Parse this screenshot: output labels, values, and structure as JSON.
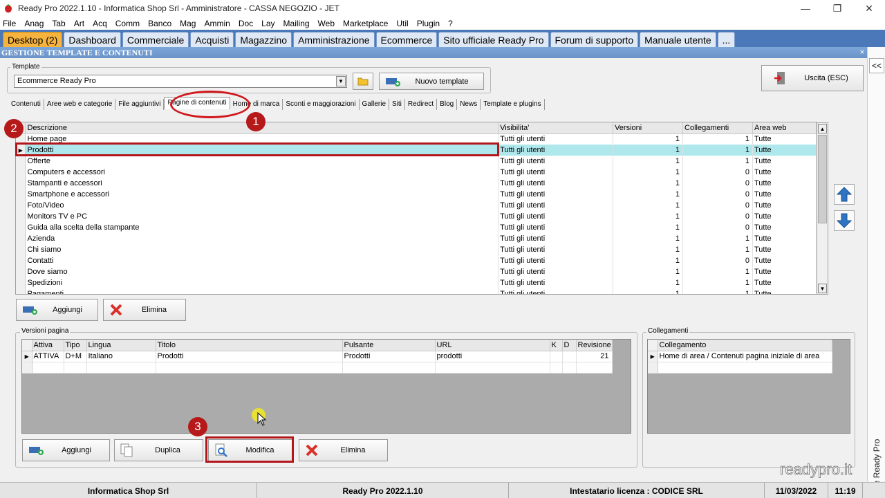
{
  "window": {
    "title": "Ready Pro 2022.1.10 - Informatica Shop Srl - Amministratore - CASSA NEGOZIO - JET",
    "minimize": "—",
    "restore": "❐",
    "close": "✕"
  },
  "menu": [
    "File",
    "Anag",
    "Tab",
    "Art",
    "Acq",
    "Comm",
    "Banco",
    "Mag",
    "Ammin",
    "Doc",
    "Lay",
    "Mailing",
    "Web",
    "Marketplace",
    "Util",
    "Plugin",
    "?"
  ],
  "module_tabs": [
    "Desktop (2)",
    "Dashboard",
    "Commerciale",
    "Acquisti",
    "Magazzino",
    "Amministrazione",
    "Ecommerce",
    "Sito ufficiale Ready Pro",
    "Forum di supporto",
    "Manuale utente",
    "..."
  ],
  "section": {
    "title": "GESTIONE TEMPLATE E CONTENUTI",
    "close": "×"
  },
  "template": {
    "label": "Template",
    "value": "Ecommerce Ready Pro",
    "new_button": "Nuovo template",
    "exit_button": "Uscita (ESC)"
  },
  "subtabs": [
    "Contenuti",
    "Aree web e categorie",
    "File aggiuntivi",
    "Pagine di contenuti",
    "Home di marca",
    "Sconti e maggiorazioni",
    "Gallerie",
    "Siti",
    "Redirect",
    "Blog",
    "News",
    "Template e plugins"
  ],
  "pages_grid": {
    "columns": [
      "Descrizione",
      "Visibilita'",
      "Versioni",
      "Collegamenti",
      "Area web"
    ],
    "rows": [
      [
        "Home page",
        "Tutti gli utenti",
        "1",
        "1",
        "Tutte"
      ],
      [
        "Prodotti",
        "Tutti gli utenti",
        "1",
        "1",
        "Tutte"
      ],
      [
        "Offerte",
        "Tutti gli utenti",
        "1",
        "1",
        "Tutte"
      ],
      [
        "Computers e accessori",
        "Tutti gli utenti",
        "1",
        "0",
        "Tutte"
      ],
      [
        "Stampanti e accessori",
        "Tutti gli utenti",
        "1",
        "0",
        "Tutte"
      ],
      [
        "Smartphone e accessori",
        "Tutti gli utenti",
        "1",
        "0",
        "Tutte"
      ],
      [
        "Foto/Video",
        "Tutti gli utenti",
        "1",
        "0",
        "Tutte"
      ],
      [
        "Monitors TV e PC",
        "Tutti gli utenti",
        "1",
        "0",
        "Tutte"
      ],
      [
        "Guida alla scelta della stampante",
        "Tutti gli utenti",
        "1",
        "0",
        "Tutte"
      ],
      [
        "Azienda",
        "Tutti gli utenti",
        "1",
        "1",
        "Tutte"
      ],
      [
        "Chi siamo",
        "Tutti gli utenti",
        "1",
        "1",
        "Tutte"
      ],
      [
        "Contatti",
        "Tutti gli utenti",
        "1",
        "0",
        "Tutte"
      ],
      [
        "Dove siamo",
        "Tutti gli utenti",
        "1",
        "1",
        "Tutte"
      ],
      [
        "Spedizioni",
        "Tutti gli utenti",
        "1",
        "1",
        "Tutte"
      ],
      [
        "Pagamenti",
        "Tutti gli utenti",
        "1",
        "1",
        "Tutte"
      ]
    ],
    "add_button": "Aggiungi",
    "delete_button": "Elimina"
  },
  "versions": {
    "label": "Versioni pagina",
    "columns": [
      "Attiva",
      "Tipo",
      "Lingua",
      "Titolo",
      "Pulsante",
      "URL",
      "K",
      "D",
      "Revisione"
    ],
    "rows": [
      [
        "ATTIVA",
        "D+M",
        "Italiano",
        "Prodotti",
        "Prodotti",
        "prodotti",
        "",
        "",
        "21"
      ]
    ],
    "buttons": {
      "add": "Aggiungi",
      "duplicate": "Duplica",
      "edit": "Modifica",
      "delete": "Elimina"
    }
  },
  "links": {
    "label": "Collegamenti",
    "column": "Collegamento",
    "rows": [
      "Home di area / Contenuti pagina iniziale di area"
    ]
  },
  "assistant_label": "Assistente Ready Pro",
  "collapse_label": "<<",
  "brand": "readypro.it",
  "status": [
    "Informatica Shop Srl",
    "Ready Pro 2022.1.10",
    "Intestatario licenza : CODICE SRL",
    "11/03/2022",
    "11:19"
  ],
  "annotations": [
    "1",
    "2",
    "3"
  ],
  "colors": {
    "accent_tab": "#f6b33d",
    "tab_bar": "#4a78b8",
    "selected_row": "#aee8ec",
    "annotation": "#b5191a"
  }
}
